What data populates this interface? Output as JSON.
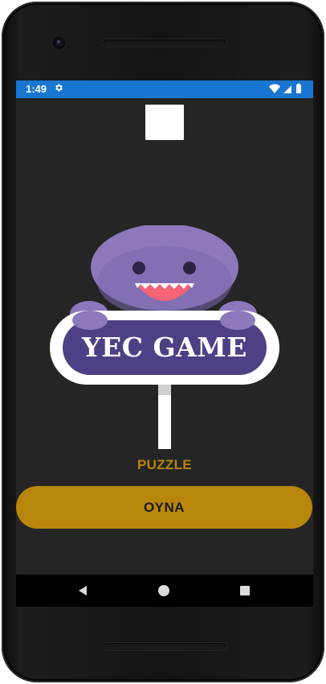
{
  "status_bar": {
    "time": "1:49",
    "icons": [
      "gear-icon",
      "wifi-icon",
      "signal-icon",
      "battery-icon"
    ],
    "background": "#1976d2"
  },
  "app": {
    "background": "#252525",
    "logo": {
      "title": "YEC GAME",
      "icon": "purple-monster-mascot"
    },
    "subtitle": "PUZZLE",
    "play_button_label": "OYNA",
    "accent_color": "#b8860b"
  },
  "nav_bar": {
    "buttons": [
      "back-icon",
      "home-icon",
      "recents-icon"
    ]
  }
}
